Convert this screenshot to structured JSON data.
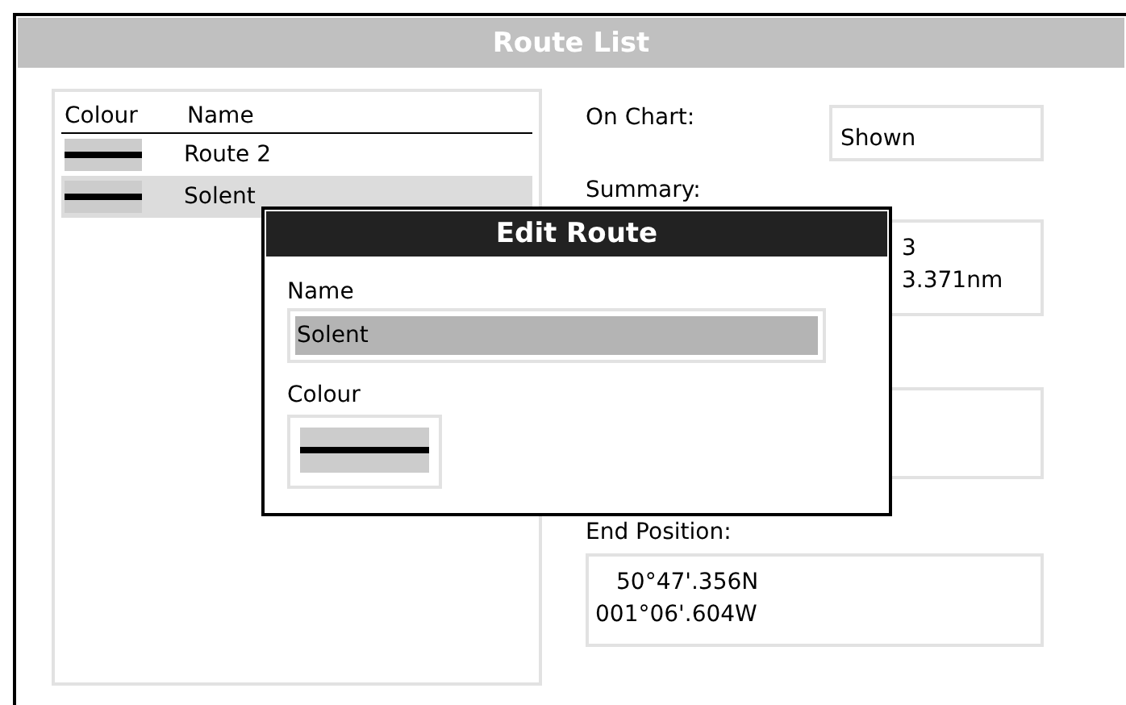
{
  "window": {
    "title": "Route List"
  },
  "route_list": {
    "columns": [
      "Colour",
      "Name"
    ],
    "rows": [
      {
        "name": "Route 2",
        "selected": false
      },
      {
        "name": "Solent",
        "selected": true
      }
    ]
  },
  "details": {
    "on_chart_label": "On Chart:",
    "on_chart_value": "Shown",
    "summary_label": "Summary:",
    "summary_lines": [
      "3",
      "3.371nm"
    ],
    "end_position_label": "End Position:",
    "end_position_lines": [
      "50°47'.356N",
      "001°06'.604W"
    ]
  },
  "dialog": {
    "title": "Edit Route",
    "name_label": "Name",
    "name_value": "Solent",
    "colour_label": "Colour"
  }
}
